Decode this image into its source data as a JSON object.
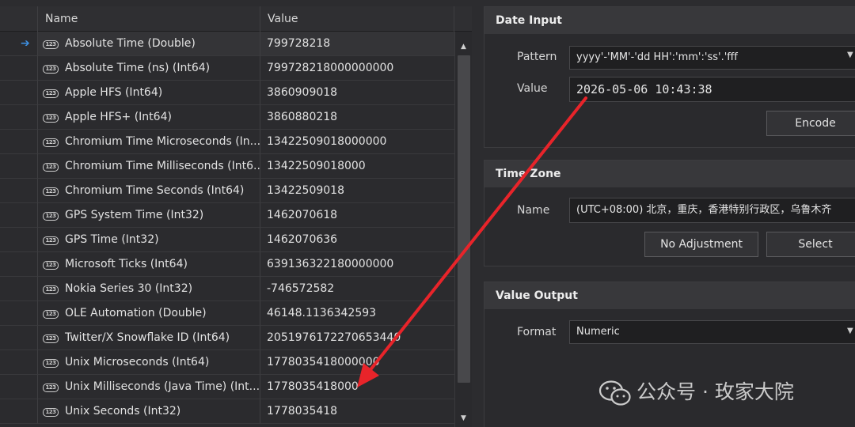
{
  "grid": {
    "columns": {
      "name": "Name",
      "value": "Value"
    },
    "selected_indicator": "➔",
    "num_icon_glyph": "123",
    "rows": [
      {
        "name": "Absolute Time (Double)",
        "value": "799728218"
      },
      {
        "name": "Absolute Time (ns) (Int64)",
        "value": "799728218000000000"
      },
      {
        "name": "Apple HFS (Int64)",
        "value": "3860909018"
      },
      {
        "name": "Apple HFS+ (Int64)",
        "value": "3860880218"
      },
      {
        "name": "Chromium Time Microseconds (In...",
        "value": "13422509018000000"
      },
      {
        "name": "Chromium Time Milliseconds (Int6...",
        "value": "13422509018000"
      },
      {
        "name": "Chromium Time Seconds (Int64)",
        "value": "13422509018"
      },
      {
        "name": "GPS System Time (Int32)",
        "value": "1462070618"
      },
      {
        "name": "GPS Time (Int32)",
        "value": "1462070636"
      },
      {
        "name": "Microsoft Ticks (Int64)",
        "value": "639136322180000000"
      },
      {
        "name": "Nokia Series 30 (Int32)",
        "value": "-746572582"
      },
      {
        "name": "OLE Automation (Double)",
        "value": "46148.1136342593"
      },
      {
        "name": "Twitter/X Snowflake ID (Int64)",
        "value": "2051976172270653440"
      },
      {
        "name": "Unix Microseconds (Int64)",
        "value": "1778035418000000"
      },
      {
        "name": "Unix Milliseconds (Java Time) (Int...",
        "value": "1778035418000"
      },
      {
        "name": "Unix Seconds (Int32)",
        "value": "1778035418"
      }
    ],
    "scroll_up": "▲",
    "scroll_down": "▼"
  },
  "date_input": {
    "title": "Date Input",
    "pattern_label": "Pattern",
    "pattern_value": "yyyy'-'MM'-'dd HH':'mm':'ss'.'fff",
    "value_label": "Value",
    "value": "2026-05-06 10:43:38",
    "encode_button": "Encode"
  },
  "time_zone": {
    "title": "Time Zone",
    "name_label": "Name",
    "name_value": "(UTC+08:00) 北京，重庆，香港特别行政区，乌鲁木齐",
    "no_adjustment_button": "No Adjustment",
    "select_button": "Select"
  },
  "value_output": {
    "title": "Value Output",
    "format_label": "Format",
    "format_value": "Numeric"
  },
  "dropdown_arrow": "▼",
  "watermark": {
    "text": "公众号 · 玫家大院"
  },
  "colors": {
    "background": "#2c2c2f",
    "accent_blue": "#3d8fe0",
    "annotation_red": "#e8242a"
  }
}
